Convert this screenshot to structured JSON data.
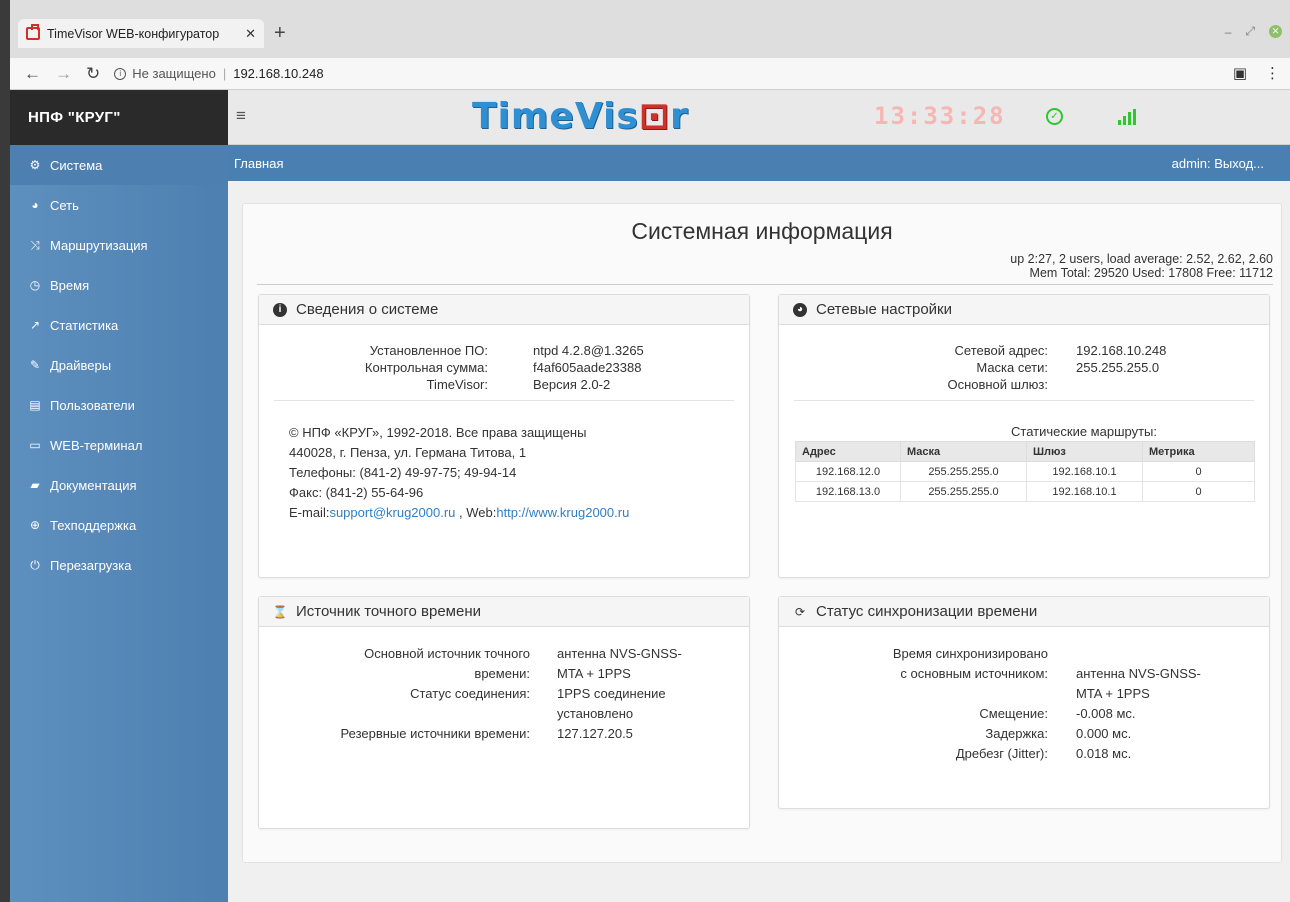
{
  "browser": {
    "tab_title": "TimeVisor WEB-конфигуратор",
    "tab_close": "✕",
    "new_tab": "+",
    "not_secure": "Не защищено",
    "url": "192.168.10.248"
  },
  "sidebar": {
    "brand": "НПФ \"КРУГ\"",
    "items": [
      {
        "label": "Система",
        "icon": "cogs-icon"
      },
      {
        "label": "Сеть",
        "icon": "globe-icon"
      },
      {
        "label": "Маршрутизация",
        "icon": "random-icon"
      },
      {
        "label": "Время",
        "icon": "clock-icon"
      },
      {
        "label": "Статистика",
        "icon": "chart-icon"
      },
      {
        "label": "Драйверы",
        "icon": "wrench-icon"
      },
      {
        "label": "Пользователи",
        "icon": "id-card-icon"
      },
      {
        "label": "WEB-терминал",
        "icon": "laptop-icon"
      },
      {
        "label": "Документация",
        "icon": "book-icon"
      },
      {
        "label": "Техподдержка",
        "icon": "lifebuoy-icon"
      },
      {
        "label": "Перезагрузка",
        "icon": "power-icon"
      }
    ]
  },
  "topbar": {
    "logo_prefix": "TimeVis",
    "logo_accent": "⊡",
    "logo_suffix": "r",
    "clock": "13:33:28",
    "colors": {
      "logo_blue": "#2f8fd3",
      "logo_red": "#d0302a",
      "clock": "#f4b7b3",
      "status_green": "#2fc72f"
    }
  },
  "breadcrumb": {
    "current": "Главная",
    "user": "admin:",
    "logout": "Выход..."
  },
  "main": {
    "title": "Системная информация",
    "uptime_line1": "up 2:27, 2 users, load average: 2.52, 2.62, 2.60",
    "uptime_line2": "Mem  Total: 29520  Used: 17808  Free: 11712"
  },
  "system_panel": {
    "title": "Сведения о системе",
    "rows": [
      {
        "k": "Установленное ПО:",
        "v": "ntpd 4.2.8@1.3265"
      },
      {
        "k": "Контрольная сумма:",
        "v": "f4af605aade23388"
      },
      {
        "k": "TimeVisor:",
        "v": "Версия 2.0-2"
      }
    ],
    "copyright": "© НПФ «КРУГ», 1992-2018. Все права защищены",
    "address": "440028, г. Пенза, ул. Германа Титова, 1",
    "phones": "Телефоны: (841-2) 49-97-75; 49-94-14",
    "fax": "Факс: (841-2) 55-64-96",
    "email_label": "E-mail:",
    "email": "support@krug2000.ru",
    "web_label": " , Web:",
    "web": "http://www.krug2000.ru"
  },
  "network_panel": {
    "title": "Сетевые настройки",
    "rows": [
      {
        "k": "Сетевой адрес:",
        "v": "192.168.10.248"
      },
      {
        "k": "Маска сети:",
        "v": "255.255.255.0"
      },
      {
        "k": "Основной шлюз:",
        "v": ""
      }
    ],
    "routes_title": "Статические маршруты:",
    "routes_headers": [
      "Адрес",
      "Маска",
      "Шлюз",
      "Метрика"
    ],
    "routes": [
      [
        "192.168.12.0",
        "255.255.255.0",
        "192.168.10.1",
        "0"
      ],
      [
        "192.168.13.0",
        "255.255.255.0",
        "192.168.10.1",
        "0"
      ]
    ]
  },
  "time_source_panel": {
    "title": "Источник точного времени",
    "primary_k1": "Основной источник точного",
    "primary_k2": "времени:",
    "primary_v1": "антенна NVS-GNSS-",
    "primary_v2": "MTA + 1PPS",
    "status_k": "Статус соединения:",
    "status_v1": "1PPS соединение",
    "status_v2": "установлено",
    "backup_k": "Резервные источники времени:",
    "backup_v": "127.127.20.5"
  },
  "sync_panel": {
    "title": "Статус синхронизации времени",
    "synced_line1": "Время синхронизировано",
    "synced_line2": "с основным источником:",
    "source_v1": "антенна NVS-GNSS-",
    "source_v2": "MTA + 1PPS",
    "offset_k": "Смещение:",
    "offset_v": "-0.008 мс.",
    "delay_k": "Задержка:",
    "delay_v": "0.000 мс.",
    "jitter_k": "Дребезг (Jitter):",
    "jitter_v": "0.018 мс."
  }
}
